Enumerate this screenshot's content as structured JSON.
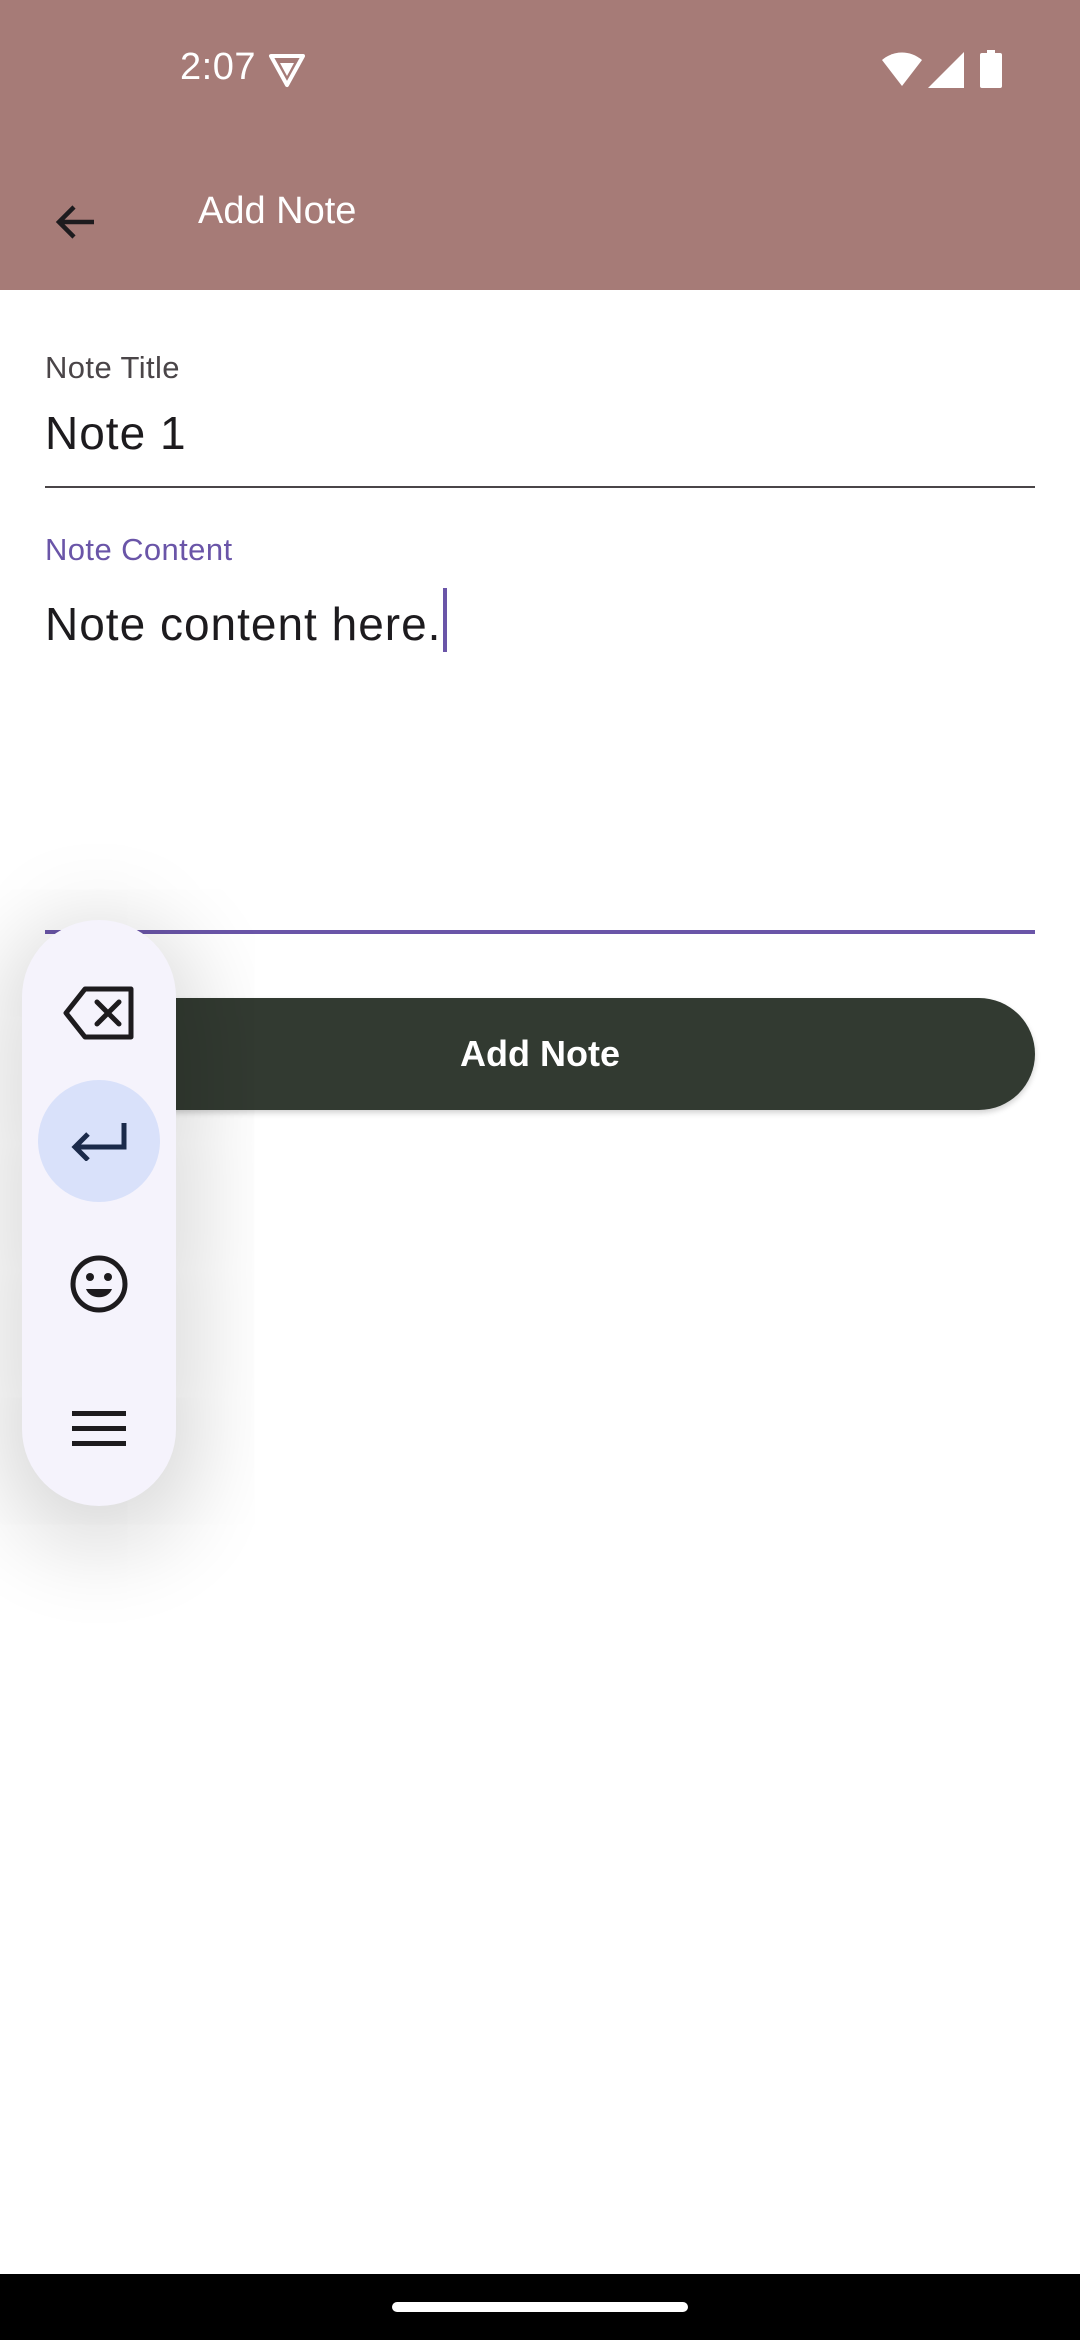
{
  "status_bar": {
    "time": "2:07",
    "icons": [
      "vpn-shield-icon",
      "wifi-icon",
      "cell-signal-icon",
      "battery-icon"
    ]
  },
  "app_bar": {
    "title": "Add Note",
    "back_icon": "arrow-back-icon",
    "background_color": "#a67b77"
  },
  "form": {
    "title_field": {
      "label": "Note Title",
      "value": "Note 1"
    },
    "content_field": {
      "label": "Note Content",
      "value": "Note content here.",
      "focused": true
    },
    "submit_label": "Add Note"
  },
  "floating_toolbar": {
    "items": [
      {
        "icon": "backspace-icon",
        "active": false
      },
      {
        "icon": "enter-icon",
        "active": true
      },
      {
        "icon": "emoji-icon",
        "active": false
      },
      {
        "icon": "menu-icon",
        "active": false
      }
    ]
  },
  "colors": {
    "accent": "#6a55a8",
    "button": "#323a31",
    "toolbar_bg": "#f5f3fc",
    "toolbar_active": "#d9e1fa"
  }
}
